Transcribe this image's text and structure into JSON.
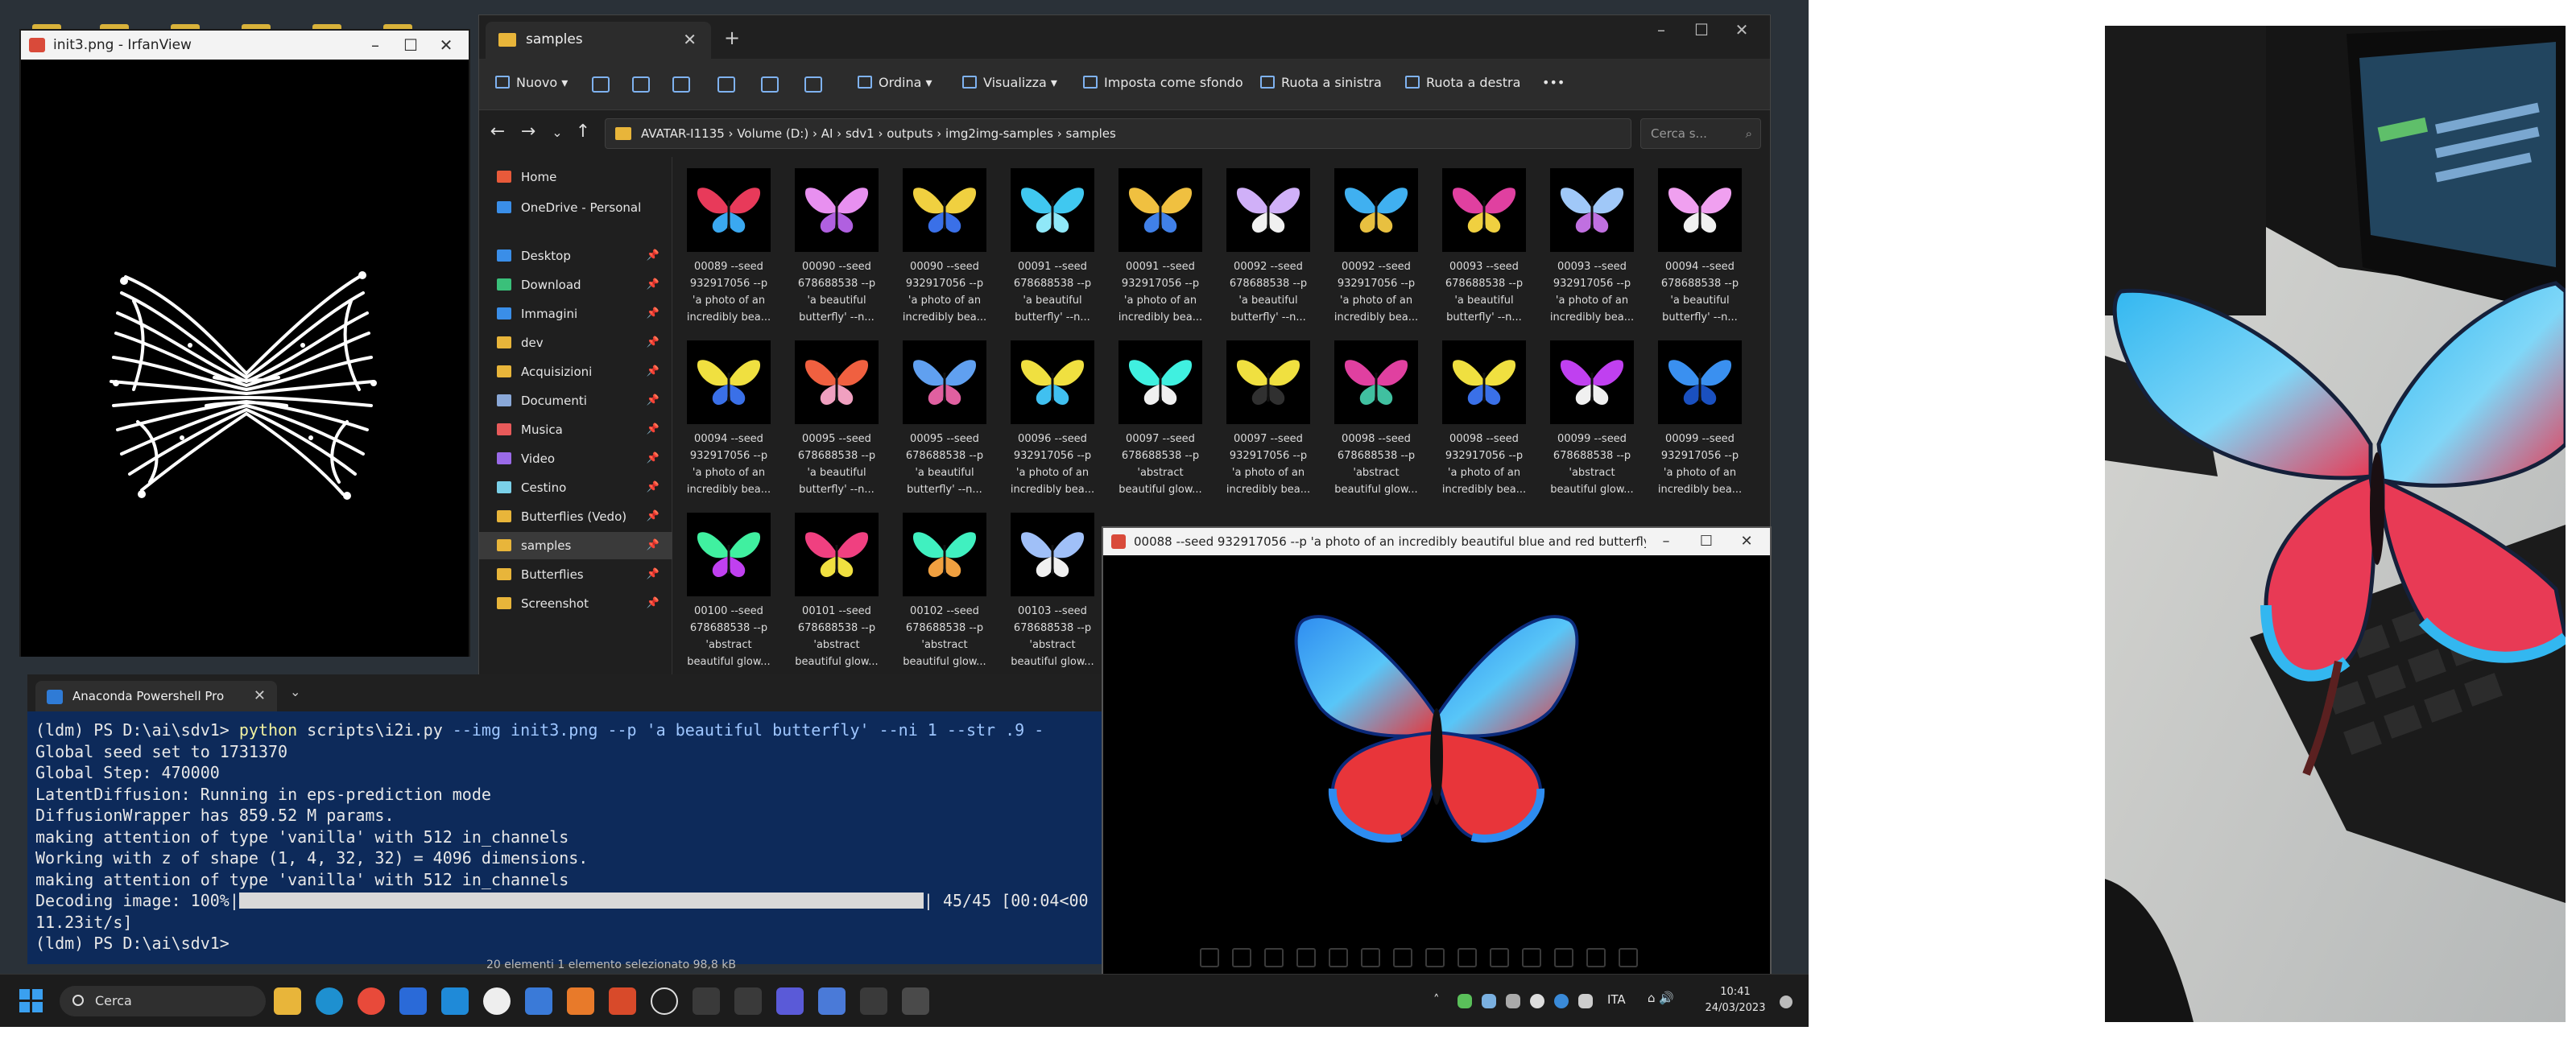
{
  "iv_window": {
    "title": "init3.png - IrfanView"
  },
  "explorer": {
    "tab_label": "samples",
    "commands": {
      "new": "Nuovo",
      "sort": "Ordina",
      "view": "Visualizza",
      "set_bg": "Imposta come sfondo",
      "rotate_left": "Ruota a sinistra",
      "rotate_right": "Ruota a destra",
      "more": "•••"
    },
    "breadcrumb": "AVATAR-I1135  ›  Volume (D:)  ›  AI  ›  sdv1  ›  outputs  ›  img2img-samples  ›  samples",
    "search_placeholder": "Cerca s...",
    "sidebar": [
      {
        "label": "Home",
        "color": "#e85a3a"
      },
      {
        "label": "OneDrive - Personal",
        "color": "#3a8ee8"
      },
      {
        "label": "Desktop",
        "color": "#3a8ee8"
      },
      {
        "label": "Download",
        "color": "#3ac07a"
      },
      {
        "label": "Immagini",
        "color": "#3a8ee8"
      },
      {
        "label": "dev",
        "color": "#e8b53a"
      },
      {
        "label": "Acquisizioni",
        "color": "#e8b53a"
      },
      {
        "label": "Documenti",
        "color": "#8aa8d8"
      },
      {
        "label": "Musica",
        "color": "#e85a5a"
      },
      {
        "label": "Video",
        "color": "#9a6ae8"
      },
      {
        "label": "Cestino",
        "color": "#7ad0e8"
      },
      {
        "label": "Butterflies (Vedo)",
        "color": "#e8b53a"
      },
      {
        "label": "samples",
        "color": "#e8b53a"
      },
      {
        "label": "Butterflies",
        "color": "#e8b53a"
      },
      {
        "label": "Screenshot",
        "color": "#e8b53a"
      }
    ],
    "thumbnails": [
      {
        "caption": "00089 --seed\n932917056 --p\n'a photo of an\nincredibly bea...",
        "colors": [
          "#e83a5a",
          "#3aa8f0"
        ]
      },
      {
        "caption": "00090 --seed\n678688538 --p\n'a beautiful\nbutterfly' --n...",
        "colors": [
          "#e890f0",
          "#b060e0"
        ]
      },
      {
        "caption": "00090 --seed\n932917056 --p\n'a photo of an\nincredibly bea...",
        "colors": [
          "#f0d040",
          "#3a70e8"
        ]
      },
      {
        "caption": "00091 --seed\n678688538 --p\n'a beautiful\nbutterfly' --n...",
        "colors": [
          "#40c8f0",
          "#90e8f8"
        ]
      },
      {
        "caption": "00091 --seed\n932917056 --p\n'a photo of an\nincredibly bea...",
        "colors": [
          "#f0c040",
          "#4080e8"
        ]
      },
      {
        "caption": "00092 --seed\n678688538 --p\n'a beautiful\nbutterfly' --n...",
        "colors": [
          "#d0b0f8",
          "#f0f0f0"
        ]
      },
      {
        "caption": "00092 --seed\n932917056 --p\n'a photo of an\nincredibly bea...",
        "colors": [
          "#40b0f0",
          "#e8c040"
        ]
      },
      {
        "caption": "00093 --seed\n678688538 --p\n'a beautiful\nbutterfly' --n...",
        "colors": [
          "#e040a0",
          "#f0d040"
        ]
      },
      {
        "caption": "00093 --seed\n932917056 --p\n'a photo of an\nincredibly bea...",
        "colors": [
          "#a0c8f8",
          "#c070e0"
        ]
      },
      {
        "caption": "00094 --seed\n678688538 --p\n'a beautiful\nbutterfly' --n...",
        "colors": [
          "#f0a0f0",
          "#f0f0f0"
        ]
      },
      {
        "caption": "00094 --seed\n932917056 --p\n'a photo of an\nincredibly bea...",
        "colors": [
          "#f0e040",
          "#3a70e8"
        ]
      },
      {
        "caption": "00095 --seed\n678688538 --p\n'a beautiful\nbutterfly' --n...",
        "colors": [
          "#f06040",
          "#f0a0c0"
        ]
      },
      {
        "caption": "00095 --seed\n678688538 --p\n'a beautiful\nbutterfly' --n...",
        "colors": [
          "#60a0f0",
          "#e060a0"
        ]
      },
      {
        "caption": "00096 --seed\n932917056 --p\n'a photo of an\nincredibly bea...",
        "colors": [
          "#f0e040",
          "#40c0f0"
        ]
      },
      {
        "caption": "00097 --seed\n678688538 --p\n'abstract\nbeautiful glow...",
        "colors": [
          "#40f0e0",
          "#f0f0f0"
        ]
      },
      {
        "caption": "00097 --seed\n932917056 --p\n'a photo of an\nincredibly bea...",
        "colors": [
          "#f0e040",
          "#303030"
        ]
      },
      {
        "caption": "00098 --seed\n678688538 --p\n'abstract\nbeautiful glow...",
        "colors": [
          "#e040a0",
          "#40c0a0"
        ]
      },
      {
        "caption": "00098 --seed\n932917056 --p\n'a photo of an\nincredibly bea...",
        "colors": [
          "#f0e040",
          "#3a70e8"
        ]
      },
      {
        "caption": "00099 --seed\n678688538 --p\n'abstract\nbeautiful glow...",
        "colors": [
          "#c040f0",
          "#f0f0f0"
        ]
      },
      {
        "caption": "00099 --seed\n932917056 --p\n'a photo of an\nincredibly bea...",
        "colors": [
          "#3a90f0",
          "#1a50c0"
        ]
      },
      {
        "caption": "00100 --seed\n678688538 --p\n'abstract\nbeautiful glow...",
        "colors": [
          "#40f0a0",
          "#c040f0"
        ]
      },
      {
        "caption": "00101 --seed\n678688538 --p\n'abstract\nbeautiful glow...",
        "colors": [
          "#f04080",
          "#f0e040"
        ]
      },
      {
        "caption": "00102 --seed\n678688538 --p\n'abstract\nbeautiful glow...",
        "colors": [
          "#40f0c0",
          "#f0a040"
        ]
      },
      {
        "caption": "00103 --seed\n678688538 --p\n'abstract\nbeautiful glow...",
        "colors": [
          "#a0c0f8",
          "#f0f0f0"
        ]
      }
    ],
    "status": "20 elementi   1 elemento selezionato 98,8 kB"
  },
  "photo_viewer": {
    "title": "00088 --seed 932917056 --p 'a photo of an incredibly beautiful blue and red butterfly' ..."
  },
  "terminal": {
    "tab_label": "Anaconda Powershell Pro",
    "prompt": "(ldm) PS D:\\ai\\sdv1>",
    "cmd": "python",
    "cmd_rest": " scripts\\i2i.py ",
    "args": "--img init3.png --p 'a beautiful butterfly' --ni 1 --str .9 -",
    "lines": [
      "Global seed set to 1731370",
      "Global Step: 470000",
      "LatentDiffusion: Running in eps-prediction mode",
      "DiffusionWrapper has 859.52 M params.",
      "making attention of type 'vanilla' with 512 in_channels",
      "Working with z of shape (1, 4, 32, 32) = 4096 dimensions.",
      "making attention of type 'vanilla' with 512 in_channels"
    ],
    "decoding_label": "Decoding image: 100%|",
    "decoding_suffix": "| 45/45 [00:04<00",
    "rate_line": "11.23it/s]",
    "final_prompt": "(ldm) PS D:\\ai\\sdv1>",
    "progress": 1.0
  },
  "taskbar": {
    "search_label": "Cerca",
    "tray_lang": "ITA",
    "clock_time": "10:41",
    "clock_date": "24/03/2023"
  }
}
